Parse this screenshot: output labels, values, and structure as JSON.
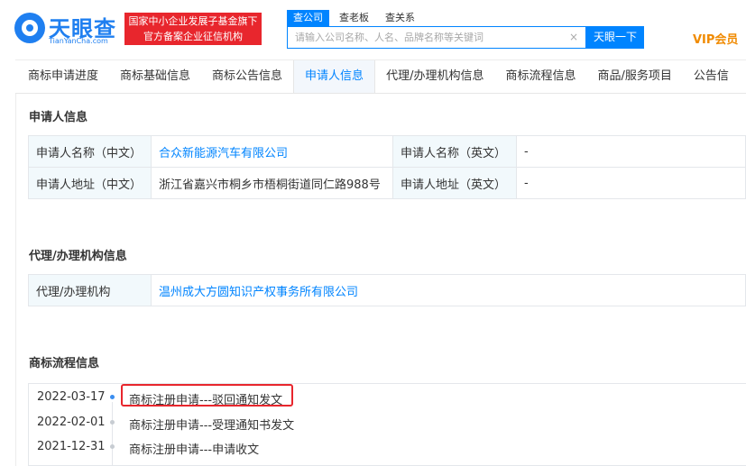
{
  "header": {
    "logo_text": "天眼查",
    "logo_sub": "TianYanCha.com",
    "badge_line1": "国家中小企业发展子基金旗下",
    "badge_line2": "官方备案企业征信机构",
    "search_tabs": [
      "查公司",
      "查老板",
      "查关系"
    ],
    "search_placeholder": "请输入公司名称、人名、品牌名称等关键词",
    "clear_symbol": "×",
    "search_button": "天眼一下",
    "vip_label": "VIP会员"
  },
  "tabs": [
    "商标申请进度",
    "商标基础信息",
    "商标公告信息",
    "申请人信息",
    "代理/办理机构信息",
    "商标流程信息",
    "商品/服务项目",
    "公告信"
  ],
  "applicant": {
    "title": "申请人信息",
    "name_cn_label": "申请人名称（中文）",
    "name_cn_value": "合众新能源汽车有限公司",
    "name_en_label": "申请人名称（英文）",
    "name_en_value": "-",
    "addr_cn_label": "申请人地址（中文）",
    "addr_cn_value": "浙江省嘉兴市桐乡市梧桐街道同仁路988号",
    "addr_en_label": "申请人地址（英文）",
    "addr_en_value": "-"
  },
  "agent": {
    "title": "代理/办理机构信息",
    "label": "代理/办理机构",
    "value": "温州成大方圆知识产权事务所有限公司"
  },
  "flow": {
    "title": "商标流程信息",
    "items": [
      {
        "date": "2022-03-17",
        "text": "商标注册申请---驳回通知发文"
      },
      {
        "date": "2022-02-01",
        "text": "商标注册申请---受理通知书发文"
      },
      {
        "date": "2021-12-31",
        "text": "商标注册申请---申请收文"
      }
    ]
  },
  "colors": {
    "brand": "#0084ff",
    "badge": "#e8262d",
    "vip": "#f08a00"
  }
}
